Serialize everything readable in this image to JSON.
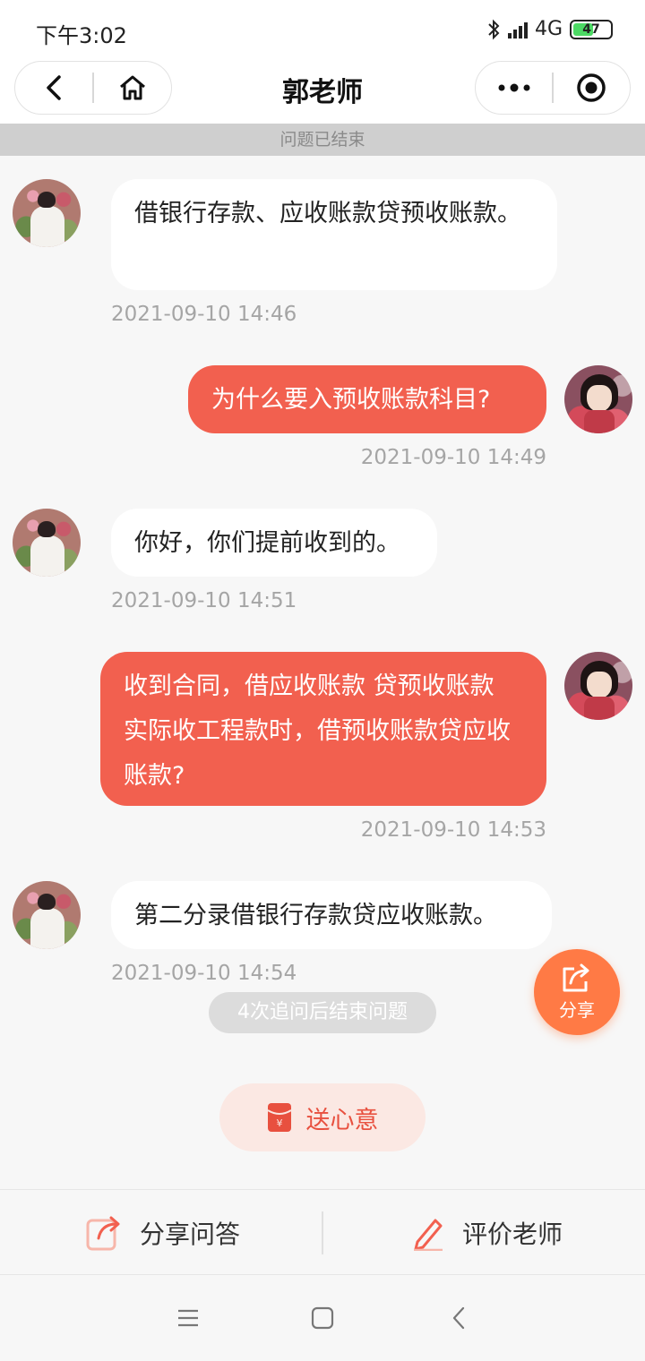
{
  "status": {
    "time": "下午3:02",
    "network": "4G",
    "battery": "47"
  },
  "nav": {
    "title": "郭老师"
  },
  "banner": {
    "text": "问题已结束"
  },
  "messages": [
    {
      "side": "in",
      "text": "借银行存款、应收账款贷预收账款。",
      "time": "2021-09-10 14:46"
    },
    {
      "side": "out",
      "text": "为什么要入预收账款科目?",
      "time": "2021-09-10 14:49"
    },
    {
      "side": "in",
      "text": "你好，你们提前收到的。",
      "time": "2021-09-10 14:51"
    },
    {
      "side": "out",
      "text": "收到合同，借应收账款 贷预收账款 实际收工程款时，借预收账款贷应收账款?",
      "time": "2021-09-10 14:53"
    },
    {
      "side": "in",
      "text": "第二分录借银行存款贷应收账款。",
      "time": "2021-09-10 14:54"
    }
  ],
  "tip": {
    "text": "4次追问后结束问题"
  },
  "share_fab": {
    "label": "分享"
  },
  "gift": {
    "label": "送心意"
  },
  "actions": {
    "share_label": "分享问答",
    "rate_label": "评价老师"
  },
  "colors": {
    "accent": "#f2604f",
    "fab": "#ff7a45",
    "gift_text": "#e8503f"
  }
}
